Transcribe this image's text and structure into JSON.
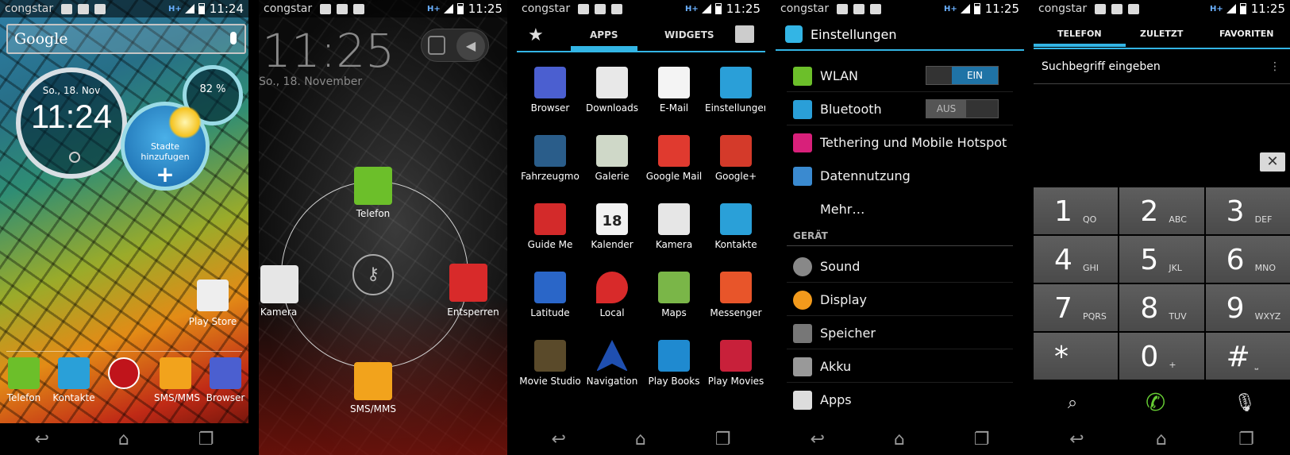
{
  "status": {
    "carrier": "congstar",
    "network": "H+",
    "times": [
      "11:24",
      "11:25",
      "11:25",
      "11:25",
      "11:25"
    ]
  },
  "home": {
    "search_label": "Google",
    "clock": {
      "date": "So., 18. Nov",
      "time": "11:24"
    },
    "battery_percent": "82 %",
    "weather": {
      "line1": "Stadte",
      "line2": "hinzufugen"
    },
    "play_store": "Play Store",
    "dock": [
      "Telefon",
      "Kontakte",
      "SMS/MMS",
      "Browser"
    ]
  },
  "lock": {
    "time": "11:25",
    "date": "So., 18. November",
    "targets": {
      "phone": "Telefon",
      "camera": "Kamera",
      "unlock": "Entsperren",
      "sms": "SMS/MMS"
    }
  },
  "drawer": {
    "tabs": [
      "APPS",
      "WIDGETS"
    ],
    "apps": [
      "Browser",
      "Downloads",
      "E-Mail",
      "Einstellungen",
      "Fahrzeugmo",
      "Galerie",
      "Google Mail",
      "Google+",
      "Guide Me",
      "Kalender",
      "Kamera",
      "Kontakte",
      "Latitude",
      "Local",
      "Maps",
      "Messenger",
      "Movie Studio",
      "Navigation",
      "Play Books",
      "Play Movies"
    ],
    "calendar_day": "18"
  },
  "settings": {
    "title": "Einstellungen",
    "wlan": "WLAN",
    "wlan_state": "EIN",
    "bluetooth": "Bluetooth",
    "bluetooth_state": "AUS",
    "tethering": "Tethering und Mobile Hotspot",
    "data": "Datennutzung",
    "more": "Mehr…",
    "section": "GERÄT",
    "sound": "Sound",
    "display": "Display",
    "storage": "Speicher",
    "battery": "Akku",
    "apps": "Apps"
  },
  "dialer": {
    "tabs": [
      "TELEFON",
      "ZULETZT",
      "FAVORITEN"
    ],
    "search_placeholder": "Suchbegriff eingeben",
    "keys": [
      {
        "d": "1",
        "s": "QO"
      },
      {
        "d": "2",
        "s": "ABC"
      },
      {
        "d": "3",
        "s": "DEF"
      },
      {
        "d": "4",
        "s": "GHI"
      },
      {
        "d": "5",
        "s": "JKL"
      },
      {
        "d": "6",
        "s": "MNO"
      },
      {
        "d": "7",
        "s": "PQRS"
      },
      {
        "d": "8",
        "s": "TUV"
      },
      {
        "d": "9",
        "s": "WXYZ"
      },
      {
        "d": "*",
        "s": ""
      },
      {
        "d": "0",
        "s": "+"
      },
      {
        "d": "#",
        "s": "⎵"
      }
    ]
  },
  "colors": {
    "accent": "#33b5e5",
    "toggle_on": "#1f73a6"
  }
}
